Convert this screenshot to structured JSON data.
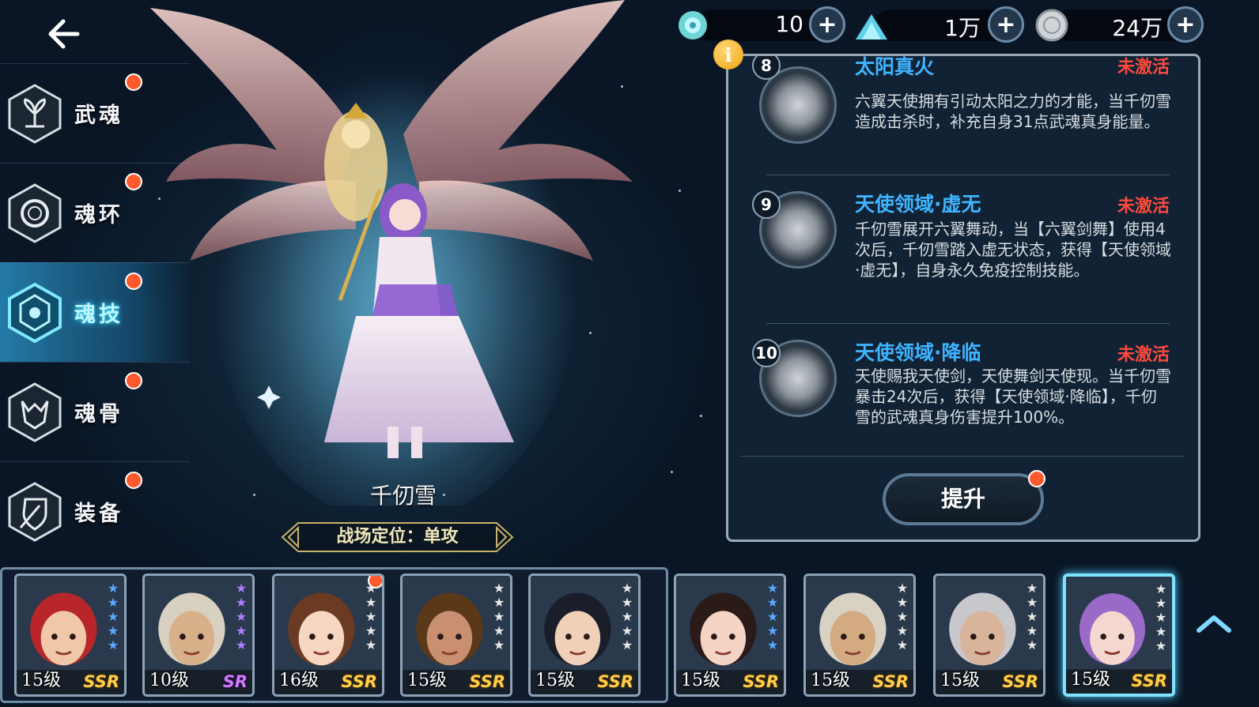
{
  "currency": [
    {
      "name": "soul-crystal",
      "value": "10"
    },
    {
      "name": "spirit-sand",
      "value": "1万"
    },
    {
      "name": "silver-coin",
      "value": "24万"
    }
  ],
  "menu": [
    {
      "id": "wuhun",
      "label": "武魂",
      "icon": "wuhun-icon",
      "active": false
    },
    {
      "id": "hunhuan",
      "label": "魂环",
      "icon": "soul-ring-icon",
      "active": false
    },
    {
      "id": "hunji",
      "label": "魂技",
      "icon": "soul-skill-icon",
      "active": true
    },
    {
      "id": "hungu",
      "label": "魂骨",
      "icon": "soul-bone-icon",
      "active": false
    },
    {
      "id": "zhuangbei",
      "label": "装备",
      "icon": "equipment-icon",
      "active": false
    }
  ],
  "character": {
    "name": "千仞雪",
    "role": "战场定位：单攻"
  },
  "skills": [
    {
      "num": "8",
      "title": "太阳真火",
      "status": "未激活",
      "desc": "六翼天使拥有引动太阳之力的才能，当千仞雪造成击杀时，补充自身31点武魂真身能量。"
    },
    {
      "num": "9",
      "title": "天使领域·虚无",
      "status": "未激活",
      "desc": "千仞雪展开六翼舞动，当【六翼剑舞】使用4次后，千仞雪踏入虚无状态，获得【天使领域·虚无】，自身永久免疫控制技能。"
    },
    {
      "num": "10",
      "title": "天使领域·降临",
      "status": "未激活",
      "desc": "天使赐我天使剑，天使舞剑天使现。当千仞雪暴击24次后，获得【天使领域·降临】，千仞雪的武魂真身伤害提升100%。"
    }
  ],
  "upgrade_label": "提升",
  "heroes": [
    {
      "level": "15级",
      "rarity": "SSR",
      "stars": 5,
      "star_color": "#5aa8ff",
      "hair": "#b8262a",
      "skin": "#f0c8a8",
      "dot": false
    },
    {
      "level": "10级",
      "rarity": "SR",
      "stars": 5,
      "star_color": "#b07bff",
      "hair": "#d8d0c0",
      "skin": "#d8b08a",
      "dot": false
    },
    {
      "level": "16级",
      "rarity": "SSR",
      "stars": 5,
      "star_color": "#e8e8e8",
      "hair": "#6a3a22",
      "skin": "#f6d6c0",
      "dot": true
    },
    {
      "level": "15级",
      "rarity": "SSR",
      "stars": 5,
      "star_color": "#e8e8e8",
      "hair": "#5a3818",
      "skin": "#c89070",
      "dot": false
    },
    {
      "level": "15级",
      "rarity": "SSR",
      "stars": 5,
      "star_color": "#e8e8e8",
      "hair": "#1a1e2a",
      "skin": "#f0d0b8",
      "dot": false
    },
    {
      "level": "15级",
      "rarity": "SSR",
      "stars": 5,
      "star_color": "#5aa8ff",
      "hair": "#2a1a18",
      "skin": "#f4d4c4",
      "dot": false
    },
    {
      "level": "15级",
      "rarity": "SSR",
      "stars": 5,
      "star_color": "#e8e8e8",
      "hair": "#d8d2c4",
      "skin": "#d4aa80",
      "dot": false
    },
    {
      "level": "15级",
      "rarity": "SSR",
      "stars": 5,
      "star_color": "#e8e8e8",
      "hair": "#c8c8cc",
      "skin": "#d8b49a",
      "dot": false
    },
    {
      "level": "15级",
      "rarity": "SSR",
      "stars": 5,
      "star_color": "#e8e8e8",
      "hair": "#9a6ac8",
      "skin": "#f4d8d0",
      "dot": false,
      "selected": true
    }
  ]
}
